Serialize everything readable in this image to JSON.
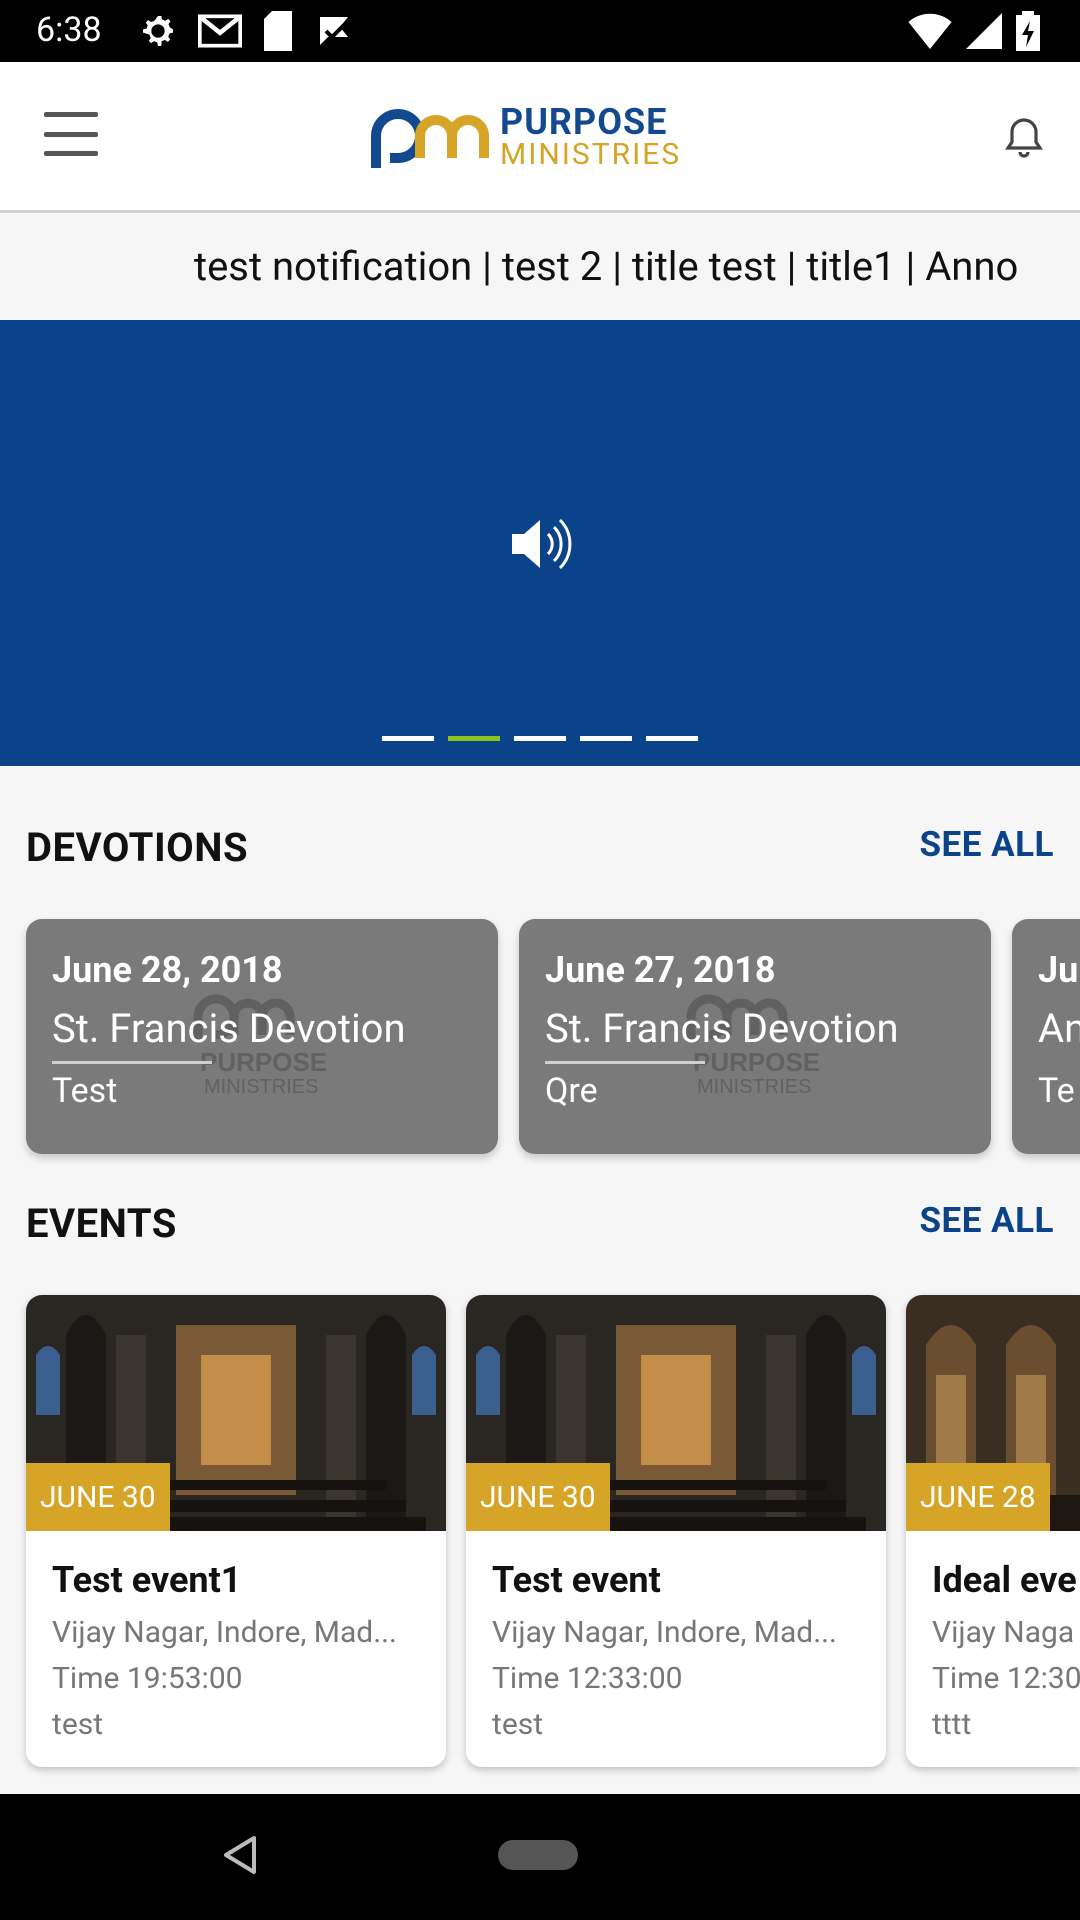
{
  "status_bar": {
    "time": "6:38",
    "icons_left": [
      "gear-icon",
      "gmail-icon",
      "sd-card-icon",
      "check-flag-icon"
    ],
    "icons_right": [
      "wifi-icon",
      "signal-icon",
      "battery-icon"
    ]
  },
  "app_bar": {
    "logo_title": "PURPOSE",
    "logo_subtitle": "MINISTRIES"
  },
  "ticker": {
    "text": "test notification | test 2 | title test | title1 | Anno"
  },
  "banner": {
    "dots_count": 5,
    "active_dot": 1,
    "background": "#0b438a"
  },
  "devotions": {
    "heading": "DEVOTIONS",
    "see_all": "SEE ALL",
    "cards": [
      {
        "date": "June 28, 2018",
        "title": "St. Francis Devotion",
        "subtitle": "Test"
      },
      {
        "date": "June 27, 2018",
        "title": "St. Francis Devotion",
        "subtitle": "Qre"
      },
      {
        "date": "Ju",
        "title": "An",
        "subtitle": "Te"
      }
    ]
  },
  "events": {
    "heading": "EVENTS",
    "see_all": "SEE ALL",
    "cards": [
      {
        "badge": "JUNE 30",
        "title": "Test event1",
        "location": "Vijay Nagar, Indore, Mad...",
        "time": "Time 19:53:00",
        "desc": "test"
      },
      {
        "badge": "JUNE 30",
        "title": "Test event",
        "location": "Vijay Nagar, Indore, Mad...",
        "time": "Time 12:33:00",
        "desc": "test"
      },
      {
        "badge": "JUNE 28",
        "title": "Ideal eve",
        "location": "Vijay Naga",
        "time": "Time 12:30",
        "desc": "tttt"
      }
    ]
  },
  "colors": {
    "brand_blue": "#0b438a",
    "brand_gold": "#d6a426",
    "accent_green": "#8dc21f"
  }
}
